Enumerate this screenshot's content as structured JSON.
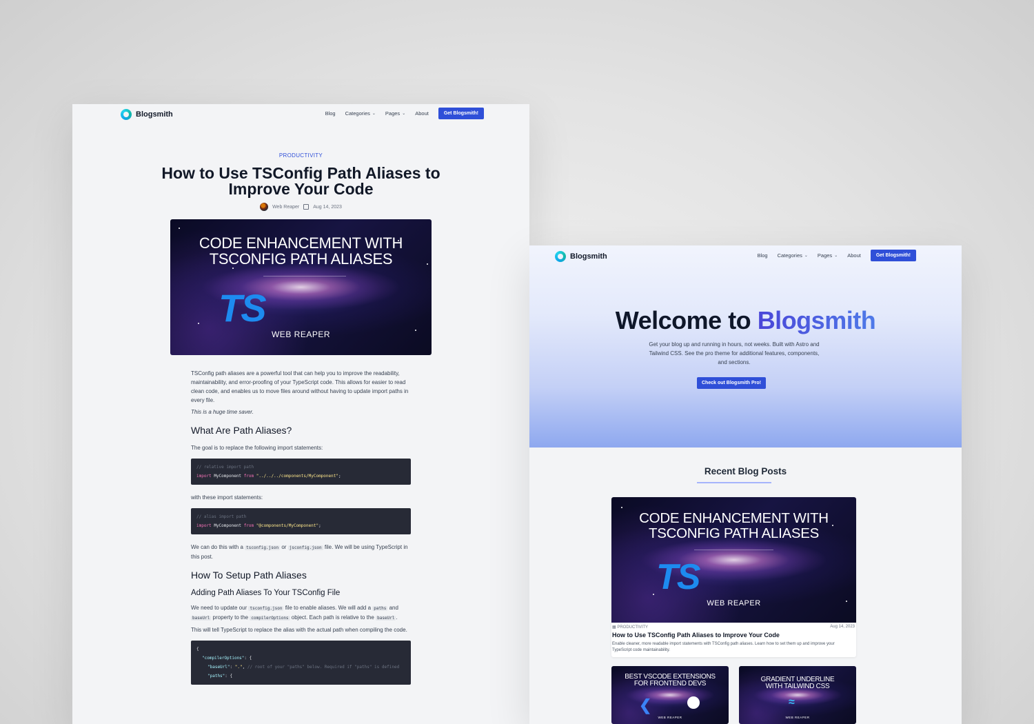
{
  "nav": {
    "logo_text": "Blogsmith",
    "links": {
      "blog": "Blog",
      "categories": "Categories",
      "pages": "Pages",
      "about": "About"
    },
    "cta": "Get Blogsmith!"
  },
  "post": {
    "category": "PRODUCTIVITY",
    "title": "How to Use TSConfig Path Aliases to Improve Your Code",
    "author": "Web Reaper",
    "date": "Aug 14, 2023",
    "image": {
      "title_line1": "CODE ENHANCEMENT WITH",
      "title_line2": "TSCONFIG PATH ALIASES",
      "ts": "TS",
      "author": "WEB REAPER"
    },
    "intro": "TSConfig path aliases are a powerful tool that can help you to improve the readability, maintainability, and error-proofing of your TypeScript code. This allows for easier to read clean code, and enables us to move files around without having to update import paths in every file.",
    "intro_em": "This is a huge time saver.",
    "h_what": "What Are Path Aliases?",
    "goal": "The goal is to replace the following import statements:",
    "code1": {
      "comment": "// relative import path",
      "kw": "import",
      "name": "MyComponent",
      "from": "from",
      "path": "\"../../../components/MyComponent\"",
      "end": ";"
    },
    "with_these": "with these import statements:",
    "code2": {
      "comment": "// alias import path",
      "kw": "import",
      "name": "MyComponent",
      "from": "from",
      "path": "\"@components/MyComponent\"",
      "end": ";"
    },
    "do_this": {
      "a": "We can do this with a",
      "code_a": "tsconfig.json",
      "b": "or",
      "code_b": "jsconfig.json",
      "c": "file. We will be using TypeScript in this post."
    },
    "h_setup": "How To Setup Path Aliases",
    "h_adding": "Adding Path Aliases To Your TSConfig File",
    "update": {
      "a": "We need to update our",
      "code_a": "tsconfig.json",
      "b": "file to enable aliases. We will add a",
      "code_b": "paths",
      "c": "and",
      "code_c": "baseUrl",
      "d": "property to the",
      "code_d": "compilerOptions",
      "e": "object. Each path is relative to the",
      "code_e": "baseUrl",
      "f": "."
    },
    "tell": "This will tell TypeScript to replace the alias with the actual path when compiling the code.",
    "code3": {
      "l1": "{",
      "l2_key": "\"compilerOptions\"",
      "l2_rest": ": {",
      "l3_key": "\"baseUrl\"",
      "l3_val": "\".\"",
      "l3_comment": "// root of your \"paths\" below. Required if \"paths\" is defined",
      "l4_key": "\"paths\"",
      "l4_rest": ": {"
    }
  },
  "home": {
    "welcome_prefix": "Welcome to",
    "welcome_brand": "Blogsmith",
    "intro": "Get your blog up and running in hours, not weeks. Built with Astro and Tailwind CSS. See the pro theme for additional features, components, and sections.",
    "cta": "Check out Blogsmith Pro!",
    "recent_title": "Recent Blog Posts",
    "card": {
      "category": "PRODUCTIVITY",
      "date": "Aug 14, 2023",
      "title": "How to Use TSConfig Path Aliases to Improve Your Code",
      "desc": "Enable cleaner, more readable import statements with TSConfig path aliases. Learn how to set them up and improve your TypeScript code maintainability."
    },
    "card_a": {
      "line1": "BEST VSCODE EXTENSIONS",
      "line2": "FOR FRONTEND DEVS",
      "author": "WEB REAPER"
    },
    "card_b": {
      "line1": "GRADIENT UNDERLINE",
      "line2": "WITH TAILWIND CSS",
      "author": "WEB REAPER"
    }
  },
  "colors": {
    "accent": "#2f4fd8",
    "brand_gradient_start": "#4a46d8",
    "code_bg": "#272a36",
    "ts_blue": "#1d8bf0"
  }
}
